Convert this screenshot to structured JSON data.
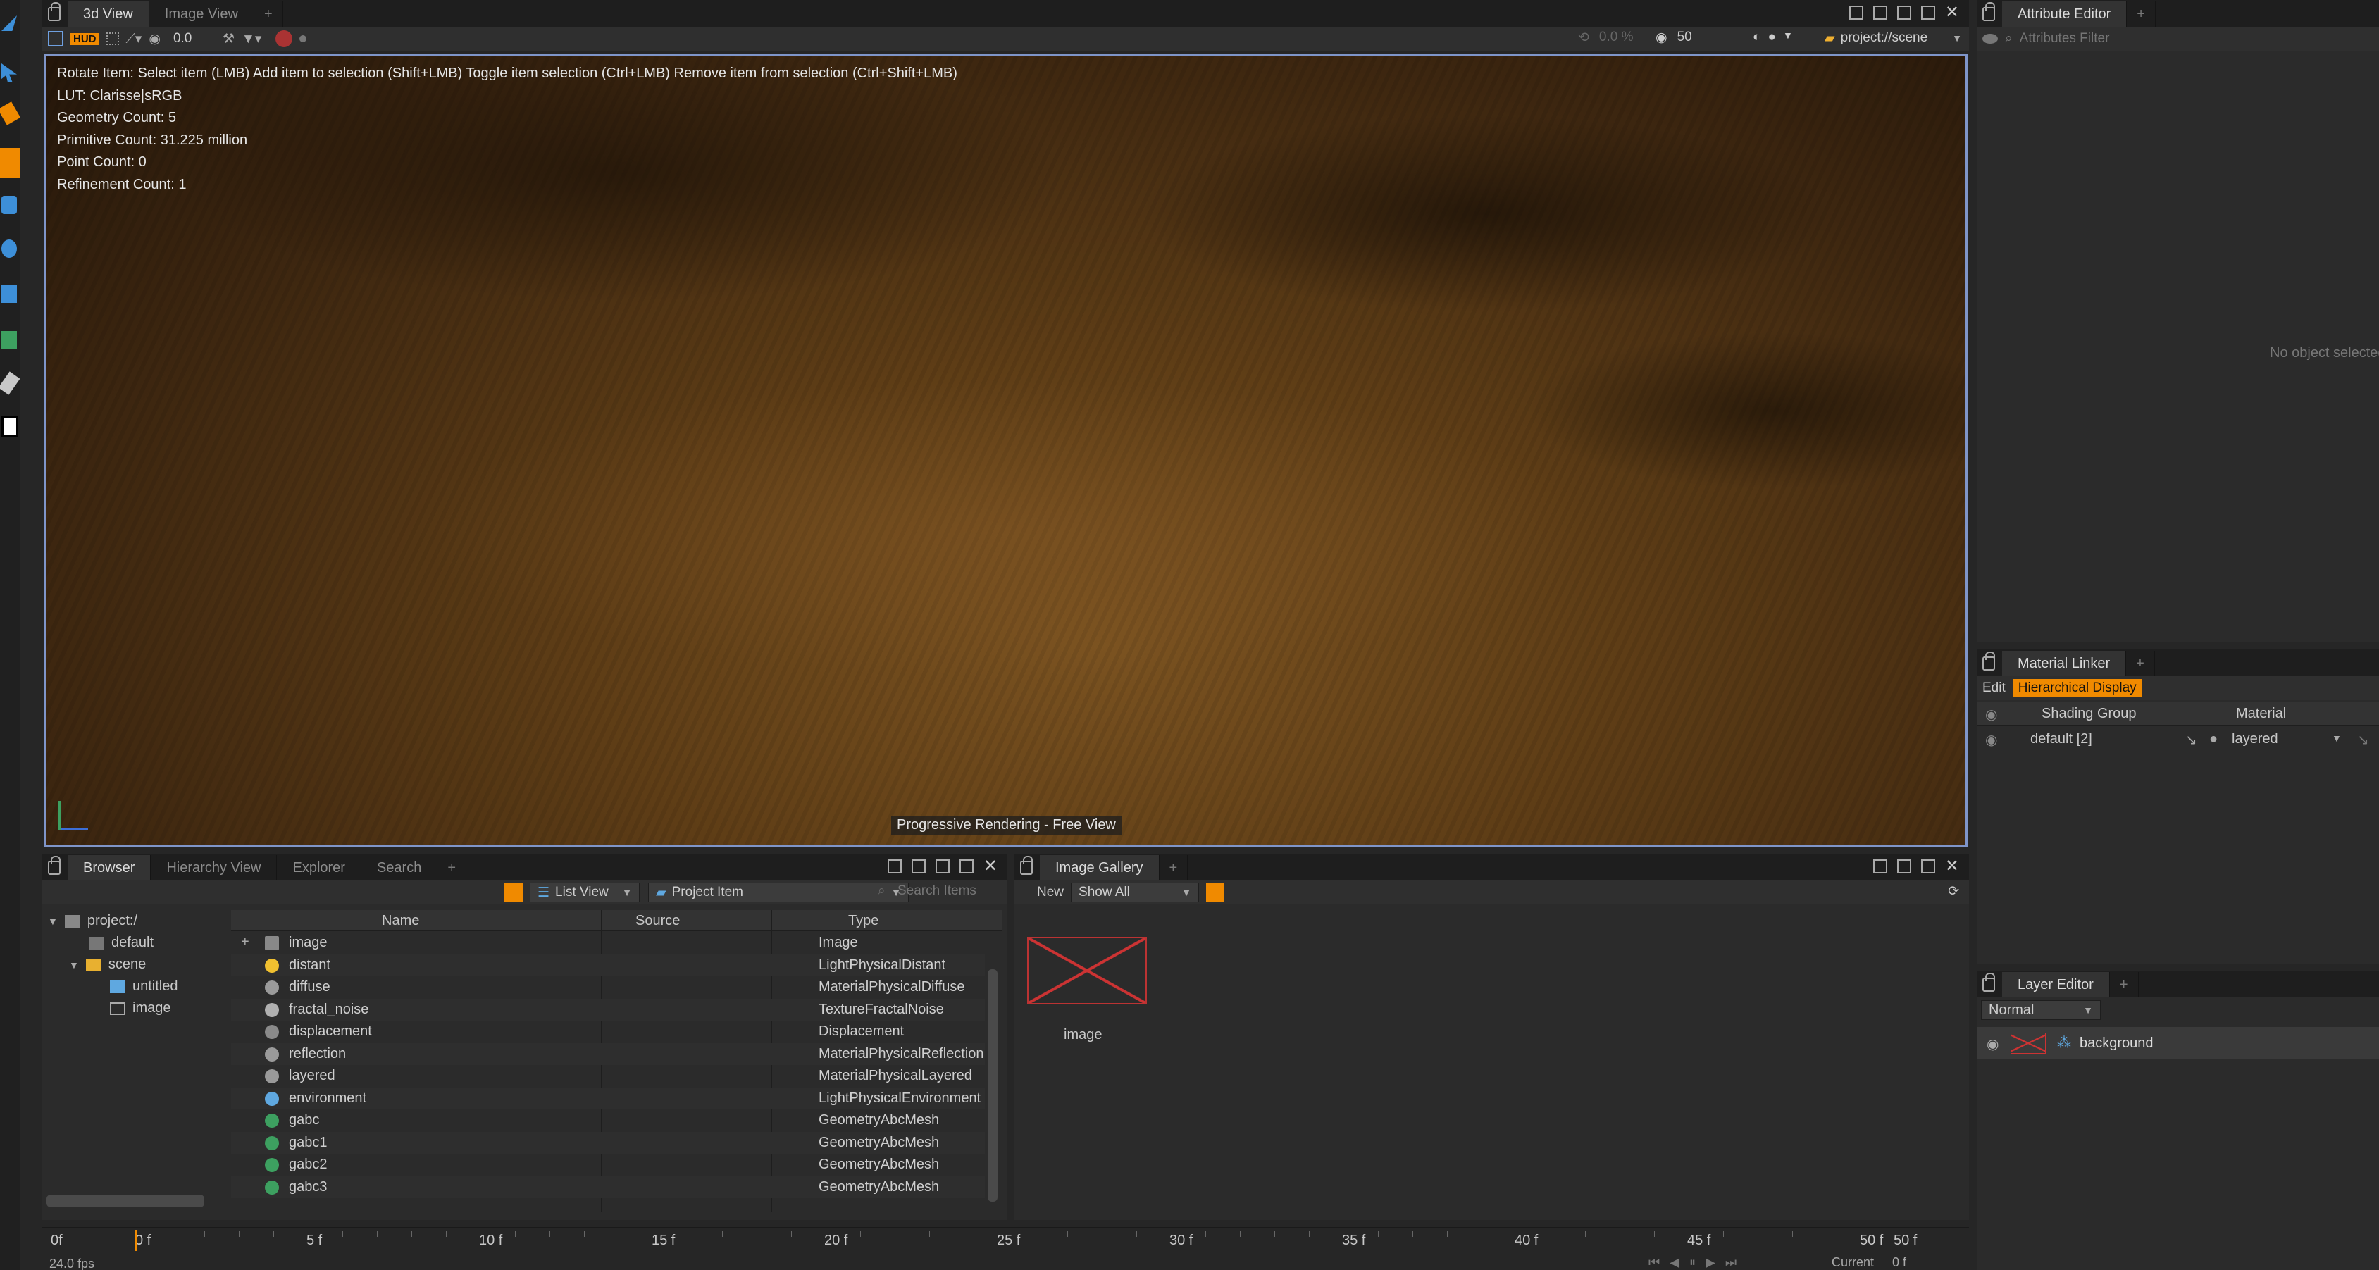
{
  "viewport": {
    "tabs": [
      "3d View",
      "Image View"
    ],
    "toolbar": {
      "hud": "HUD",
      "value": "0.0",
      "percent": "0.0 %",
      "samples": "50",
      "context": "project://scene"
    },
    "hud_lines": [
      "Rotate Item: Select item (LMB)  Add item to selection (Shift+LMB)  Toggle item selection (Ctrl+LMB)  Remove item from selection (Ctrl+Shift+LMB)",
      "LUT: Clarisse|sRGB",
      "Geometry Count: 5",
      "Primitive Count: 31.225 million",
      "Point Count: 0",
      "Refinement Count: 1"
    ],
    "status": "Progressive Rendering - Free View"
  },
  "attribute_editor": {
    "tab": "Attribute Editor",
    "filter_placeholder": "Attributes Filter",
    "empty_text": "No object selected"
  },
  "material_linker": {
    "tab": "Material Linker",
    "edit": "Edit",
    "mode": "Hierarchical Display",
    "columns": [
      "Shading Group",
      "Material"
    ],
    "row": {
      "group": "default [2]",
      "material": "layered"
    }
  },
  "layer_editor": {
    "tab": "Layer Editor",
    "blend": "Normal",
    "layer": "background"
  },
  "browser": {
    "tabs": [
      "Browser",
      "Hierarchy View",
      "Explorer",
      "Search"
    ],
    "view_mode": "List View",
    "item_filter": "Project Item",
    "search_placeholder": "Search Items",
    "tree": [
      {
        "label": "project:/",
        "depth": 0
      },
      {
        "label": "default",
        "depth": 1
      },
      {
        "label": "scene",
        "depth": 1
      },
      {
        "label": "untitled",
        "depth": 2
      },
      {
        "label": "image",
        "depth": 2
      }
    ],
    "columns": [
      "Name",
      "Source",
      "Type"
    ],
    "rows": [
      {
        "name": "image",
        "type": "Image",
        "icon": "image-icon"
      },
      {
        "name": "distant",
        "type": "LightPhysicalDistant",
        "icon": "sun-icon"
      },
      {
        "name": "diffuse",
        "type": "MaterialPhysicalDiffuse",
        "icon": "material-icon"
      },
      {
        "name": "fractal_noise",
        "type": "TextureFractalNoise",
        "icon": "texture-icon"
      },
      {
        "name": "displacement",
        "type": "Displacement",
        "icon": "displacement-icon"
      },
      {
        "name": "reflection",
        "type": "MaterialPhysicalReflection",
        "icon": "material-icon"
      },
      {
        "name": "layered",
        "type": "MaterialPhysicalLayered",
        "icon": "material-icon"
      },
      {
        "name": "environment",
        "type": "LightPhysicalEnvironment",
        "icon": "environment-icon"
      },
      {
        "name": "gabc",
        "type": "GeometryAbcMesh",
        "icon": "geometry-icon"
      },
      {
        "name": "gabc1",
        "type": "GeometryAbcMesh",
        "icon": "geometry-icon"
      },
      {
        "name": "gabc2",
        "type": "GeometryAbcMesh",
        "icon": "geometry-icon"
      },
      {
        "name": "gabc3",
        "type": "GeometryAbcMesh",
        "icon": "geometry-icon"
      }
    ]
  },
  "image_gallery": {
    "tab": "Image Gallery",
    "new": "New",
    "filter": "Show All",
    "thumb_label": "image"
  },
  "timeline": {
    "start": "0f",
    "ticks": [
      "0 f",
      "5 f",
      "10 f",
      "15 f",
      "20 f",
      "25 f",
      "30 f",
      "35 f",
      "40 f",
      "45 f",
      "50 f"
    ],
    "end": "50 f",
    "fps": "24.0 fps",
    "current_label": "Current",
    "current_value": "0 f"
  },
  "colors": {
    "accent": "#f08a00",
    "panel": "#2b2b2b",
    "viewport_border": "#7f95c9"
  }
}
